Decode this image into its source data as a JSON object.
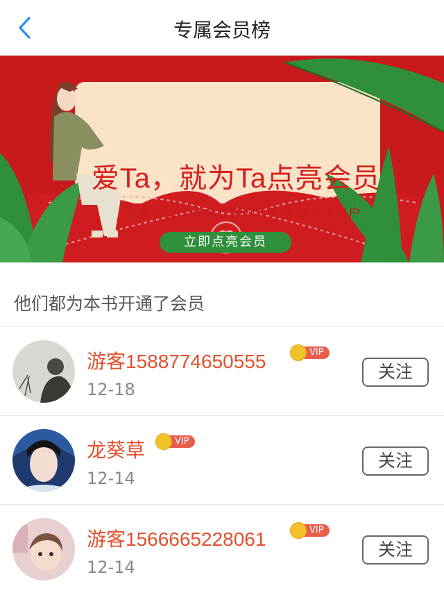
{
  "header": {
    "title": "专属会员榜",
    "back_icon": "chevron-left-icon"
  },
  "banner": {
    "headline": "爱Ta，就为Ta点亮会员",
    "subtitle": "点亮成功，收益立刻同步到作者大大账户",
    "cta_label": "立即点亮会员"
  },
  "section": {
    "label": "他们都为本书开通了会员"
  },
  "members": [
    {
      "name": "游客1588774650555",
      "badge": "VIP",
      "date": "12-18",
      "follow_label": "关注"
    },
    {
      "name": "龙葵草",
      "badge": "VIP",
      "date": "12-14",
      "follow_label": "关注"
    },
    {
      "name": "游客1566665228061",
      "badge": "VIP",
      "date": "12-14",
      "follow_label": "关注"
    }
  ],
  "colors": {
    "accent_blue": "#2f8df0",
    "banner_red": "#c8191b",
    "username_orange": "#e3502d",
    "vip_red": "#e95d4b",
    "cta_green": "#2f8f3a"
  }
}
